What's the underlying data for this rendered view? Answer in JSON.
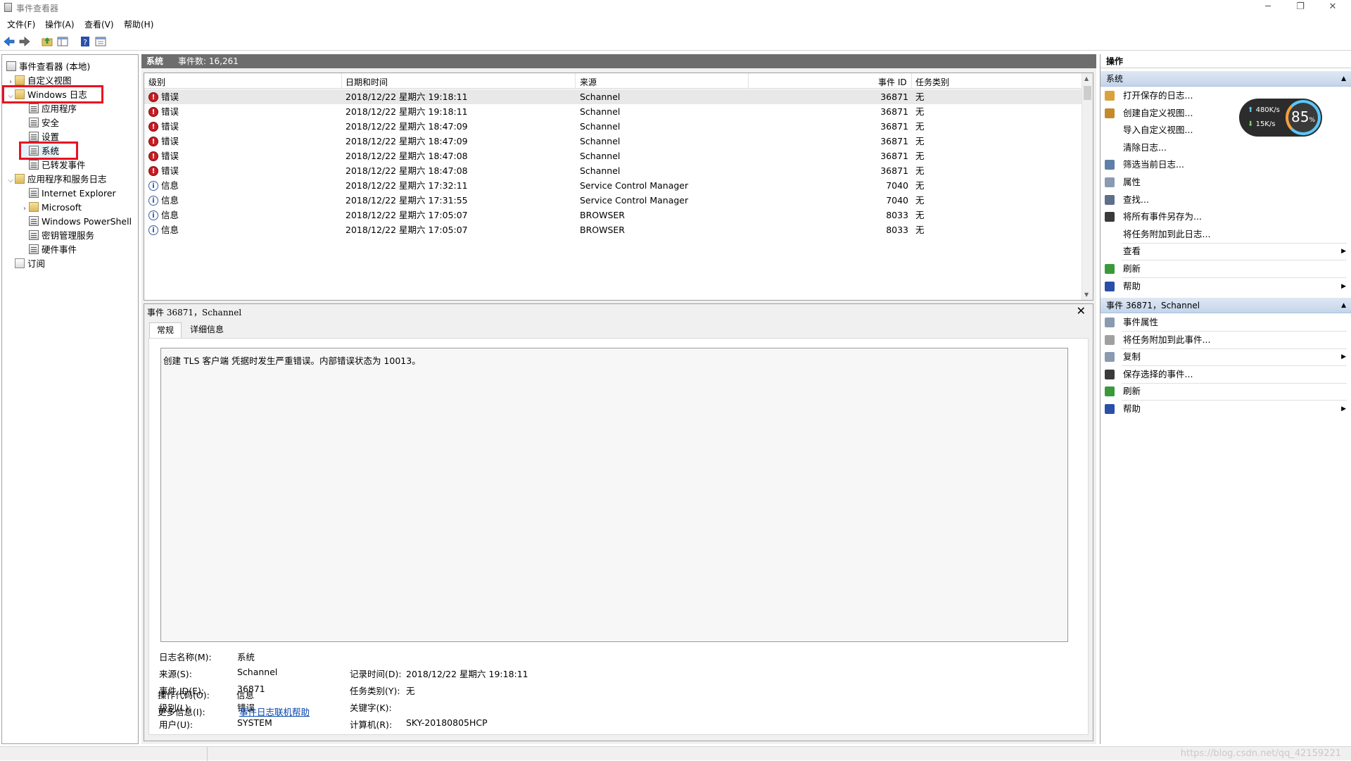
{
  "window": {
    "title": "事件查看器",
    "minimize": "─",
    "restore": "❐",
    "close": "✕"
  },
  "menu": [
    "文件(F)",
    "操作(A)",
    "查看(V)",
    "帮助(H)"
  ],
  "toolbar_icons": [
    "back-icon",
    "forward-icon",
    "up-folder-icon",
    "show-hide-tree-icon",
    "help-icon",
    "properties-icon"
  ],
  "nav": {
    "items": [
      {
        "label": "事件查看器 (本地)",
        "icon": "event-viewer-icon",
        "level": 0,
        "twisty": ""
      },
      {
        "label": "自定义视图",
        "icon": "folder-icon",
        "level": 1,
        "twisty": ">"
      },
      {
        "label": "Windows 日志",
        "icon": "folder-icon",
        "level": 1,
        "twisty": "v",
        "highlight": true
      },
      {
        "label": "应用程序",
        "icon": "log-icon",
        "level": 2,
        "twisty": ""
      },
      {
        "label": "安全",
        "icon": "log-icon",
        "level": 2,
        "twisty": ""
      },
      {
        "label": "设置",
        "icon": "log-icon",
        "level": 2,
        "twisty": ""
      },
      {
        "label": "系统",
        "icon": "log-icon",
        "level": 2,
        "twisty": "",
        "highlight": true,
        "selected": true
      },
      {
        "label": "已转发事件",
        "icon": "log-icon",
        "level": 2,
        "twisty": ""
      },
      {
        "label": "应用程序和服务日志",
        "icon": "folder-icon",
        "level": 1,
        "twisty": "v"
      },
      {
        "label": "Internet Explorer",
        "icon": "log-icon",
        "level": 2,
        "twisty": ""
      },
      {
        "label": "Microsoft",
        "icon": "folder-icon",
        "level": 2,
        "twisty": ">"
      },
      {
        "label": "Windows PowerShell",
        "icon": "log-icon",
        "level": 2,
        "twisty": ""
      },
      {
        "label": "密钥管理服务",
        "icon": "log-icon",
        "level": 2,
        "twisty": ""
      },
      {
        "label": "硬件事件",
        "icon": "log-icon",
        "level": 2,
        "twisty": ""
      },
      {
        "label": "订阅",
        "icon": "subscription-icon",
        "level": 1,
        "twisty": ""
      }
    ]
  },
  "header": {
    "log_name": "系统",
    "event_count": "事件数: 16,261"
  },
  "table": {
    "columns": [
      "级别",
      "日期和时间",
      "来源",
      "事件 ID",
      "任务类别"
    ],
    "rows": [
      {
        "level": "错误",
        "type": "error",
        "datetime": "2018/12/22 星期六 19:18:11",
        "source": "Schannel",
        "event_id": "36871",
        "task": "无"
      },
      {
        "level": "错误",
        "type": "error",
        "datetime": "2018/12/22 星期六 19:18:11",
        "source": "Schannel",
        "event_id": "36871",
        "task": "无"
      },
      {
        "level": "错误",
        "type": "error",
        "datetime": "2018/12/22 星期六 18:47:09",
        "source": "Schannel",
        "event_id": "36871",
        "task": "无"
      },
      {
        "level": "错误",
        "type": "error",
        "datetime": "2018/12/22 星期六 18:47:09",
        "source": "Schannel",
        "event_id": "36871",
        "task": "无"
      },
      {
        "level": "错误",
        "type": "error",
        "datetime": "2018/12/22 星期六 18:47:08",
        "source": "Schannel",
        "event_id": "36871",
        "task": "无"
      },
      {
        "level": "错误",
        "type": "error",
        "datetime": "2018/12/22 星期六 18:47:08",
        "source": "Schannel",
        "event_id": "36871",
        "task": "无"
      },
      {
        "level": "信息",
        "type": "info",
        "datetime": "2018/12/22 星期六 17:32:11",
        "source": "Service Control Manager",
        "event_id": "7040",
        "task": "无"
      },
      {
        "level": "信息",
        "type": "info",
        "datetime": "2018/12/22 星期六 17:31:55",
        "source": "Service Control Manager",
        "event_id": "7040",
        "task": "无"
      },
      {
        "level": "信息",
        "type": "info",
        "datetime": "2018/12/22 星期六 17:05:07",
        "source": "BROWSER",
        "event_id": "8033",
        "task": "无"
      },
      {
        "level": "信息",
        "type": "info",
        "datetime": "2018/12/22 星期六 17:05:07",
        "source": "BROWSER",
        "event_id": "8033",
        "task": "无"
      }
    ]
  },
  "detail": {
    "title": "事件 36871，Schannel",
    "close": "✕",
    "tabs": [
      "常规",
      "详细信息"
    ],
    "description": "创建 TLS 客户端 凭据时发生严重错误。内部错误状态为 10013。",
    "fields": {
      "log_name_label": "日志名称(M):",
      "log_name_value": "系统",
      "source_label": "来源(S):",
      "source_value": "Schannel",
      "logged_label": "记录时间(D):",
      "logged_value": "2018/12/22 星期六 19:18:11",
      "event_id_label": "事件 ID(E):",
      "event_id_value": "36871",
      "task_label": "任务类别(Y):",
      "task_value": "无",
      "level_label": "级别(L):",
      "level_value": "错误",
      "keywords_label": "关键字(K):",
      "keywords_value": "",
      "user_label": "用户(U):",
      "user_value": "SYSTEM",
      "computer_label": "计算机(R):",
      "computer_value": "SKY-20180805HCP",
      "opcode_label": "操作代码(O):",
      "opcode_value": "信息",
      "more_info_label": "更多信息(I):",
      "more_info_link": "事件日志联机帮助"
    }
  },
  "actions": {
    "title": "操作",
    "section1": {
      "header": "系统",
      "items": [
        {
          "label": "打开保存的日志...",
          "icon": "open-log-icon",
          "color": "#d9a23a",
          "arrow": ""
        },
        {
          "label": "创建自定义视图...",
          "icon": "create-view-filter-icon",
          "color": "#c58a2a",
          "arrow": ""
        },
        {
          "label": "导入自定义视图...",
          "icon": "",
          "color": "",
          "arrow": ""
        },
        {
          "label": "清除日志...",
          "icon": "",
          "color": "",
          "arrow": ""
        },
        {
          "label": "筛选当前日志...",
          "icon": "filter-icon",
          "color": "#5e7fa8",
          "arrow": ""
        },
        {
          "label": "属性",
          "icon": "properties-icon",
          "color": "#8a9bb0",
          "arrow": ""
        },
        {
          "label": "查找...",
          "icon": "find-icon",
          "color": "#5d6f8a",
          "arrow": ""
        },
        {
          "label": "将所有事件另存为...",
          "icon": "save-icon",
          "color": "#3a3a3a",
          "arrow": ""
        },
        {
          "label": "将任务附加到此日志...",
          "icon": "",
          "color": "",
          "arrow": ""
        },
        {
          "label": "查看",
          "icon": "",
          "color": "",
          "arrow": "▶"
        },
        {
          "label": "刷新",
          "icon": "refresh-icon",
          "color": "#3a9a3a",
          "arrow": ""
        },
        {
          "label": "帮助",
          "icon": "help-icon",
          "color": "#2a4fa8",
          "arrow": "▶"
        }
      ]
    },
    "section2": {
      "header": "事件 36871，Schannel",
      "items": [
        {
          "label": "事件属性",
          "icon": "event-properties-icon",
          "color": "#8a9bb0",
          "arrow": ""
        },
        {
          "label": "将任务附加到此事件...",
          "icon": "attach-task-icon",
          "color": "#a0a0a0",
          "arrow": ""
        },
        {
          "label": "复制",
          "icon": "copy-icon",
          "color": "#8a9bb0",
          "arrow": "▶"
        },
        {
          "label": "保存选择的事件...",
          "icon": "save-icon",
          "color": "#3a3a3a",
          "arrow": ""
        },
        {
          "label": "刷新",
          "icon": "refresh-icon",
          "color": "#3a9a3a",
          "arrow": ""
        },
        {
          "label": "帮助",
          "icon": "help-icon",
          "color": "#2a4fa8",
          "arrow": "▶"
        }
      ]
    }
  },
  "net_widget": {
    "upload": "480K/s",
    "download": "15K/s",
    "percent": "85",
    "percent_unit": "%"
  },
  "watermark": "https://blog.csdn.net/qq_42159221"
}
